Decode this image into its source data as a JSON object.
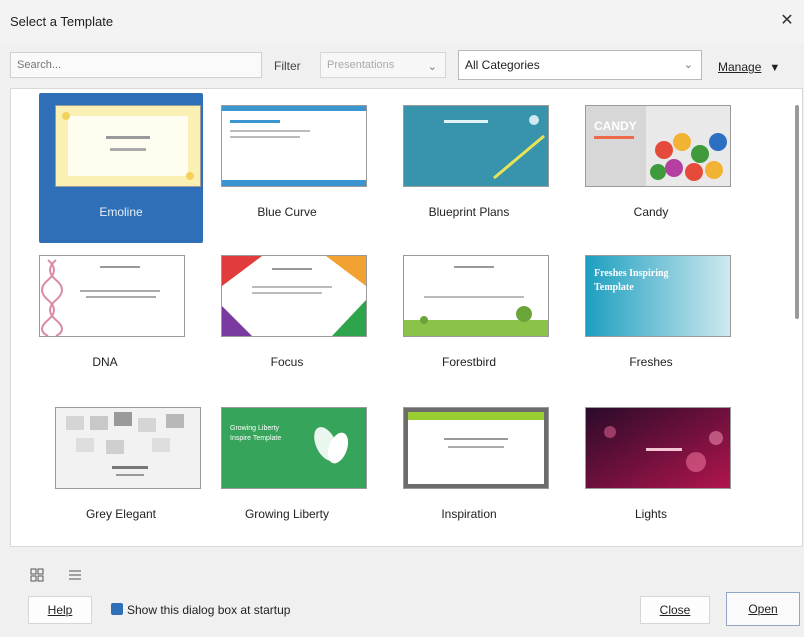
{
  "window": {
    "title": "Select a Template",
    "close_glyph": "✕"
  },
  "toolbar": {
    "search_placeholder": "Search...",
    "filter_label": "Filter",
    "filter_value": "Presentations",
    "category_value": "All Categories",
    "manage_label": "Manage"
  },
  "templates": [
    {
      "label": "Emoline",
      "selected": true
    },
    {
      "label": "Blue Curve",
      "selected": false
    },
    {
      "label": "Blueprint Plans",
      "selected": false
    },
    {
      "label": "Candy",
      "selected": false
    },
    {
      "label": "DNA",
      "selected": false
    },
    {
      "label": "Focus",
      "selected": false
    },
    {
      "label": "Forestbird",
      "selected": false
    },
    {
      "label": "Freshes",
      "selected": false
    },
    {
      "label": "Grey Elegant",
      "selected": false
    },
    {
      "label": "Growing Liberty",
      "selected": false
    },
    {
      "label": "Inspiration",
      "selected": false
    },
    {
      "label": "Lights",
      "selected": false
    }
  ],
  "thumb_text": {
    "candy": "CANDY",
    "freshes_line1": "Freshes Inspiring",
    "freshes_line2": "Template",
    "growing_line1": "Growing Liberty",
    "growing_line2": "Inspire Template"
  },
  "footer": {
    "help_label": "Help",
    "show_dialog_label": "Show this dialog box at startup",
    "show_dialog_checked": true,
    "close_label": "Close",
    "open_label": "Open"
  },
  "colors": {
    "selection": "#2f6fb7",
    "accent": "#2f6fb7"
  }
}
